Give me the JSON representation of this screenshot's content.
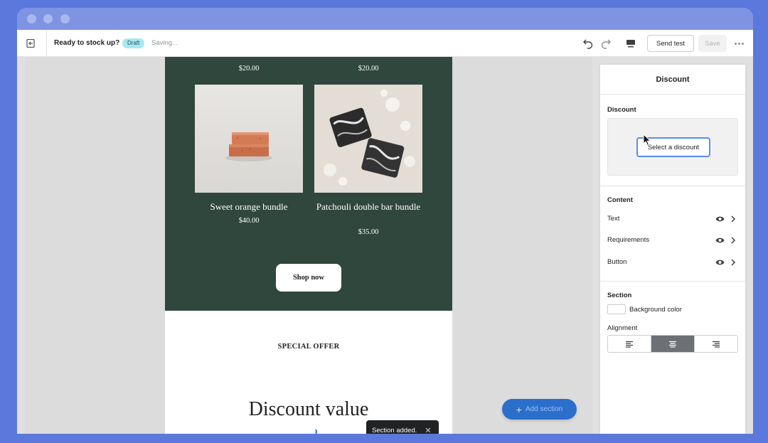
{
  "toolbar": {
    "title": "Ready to stock up?",
    "status_badge": "Draft",
    "save_status": "Saving...",
    "send_test_label": "Send test",
    "save_label": "Save"
  },
  "email": {
    "top_prices": [
      "$20.00",
      "$20.00"
    ],
    "products": [
      {
        "name": "Sweet orange bundle",
        "price": "$40.00"
      },
      {
        "name": "Patchouli double bar bundle",
        "price": "$35.00"
      }
    ],
    "shop_button_label": "Shop now",
    "offer_heading": "SPECIAL OFFER",
    "discount_heading": "Discount value"
  },
  "canvas": {
    "add_section_label": "Add section",
    "toast_message": "Section added.",
    "accent_color": "#2c6ecb"
  },
  "panel": {
    "title": "Discount",
    "discount_heading": "Discount",
    "select_discount_label": "Select a discount",
    "content_heading": "Content",
    "content_rows": [
      "Text",
      "Requirements",
      "Button"
    ],
    "section_heading": "Section",
    "background_color_label": "Background color",
    "alignment_heading": "Alignment",
    "alignment_options": [
      "left-align-icon",
      "center-align-icon",
      "right-align-icon"
    ],
    "alignment_selected": "center"
  },
  "colors": {
    "products_background": "#2f473d",
    "draft_badge": "#a4e8f2",
    "page_background": "#5b78dc"
  }
}
